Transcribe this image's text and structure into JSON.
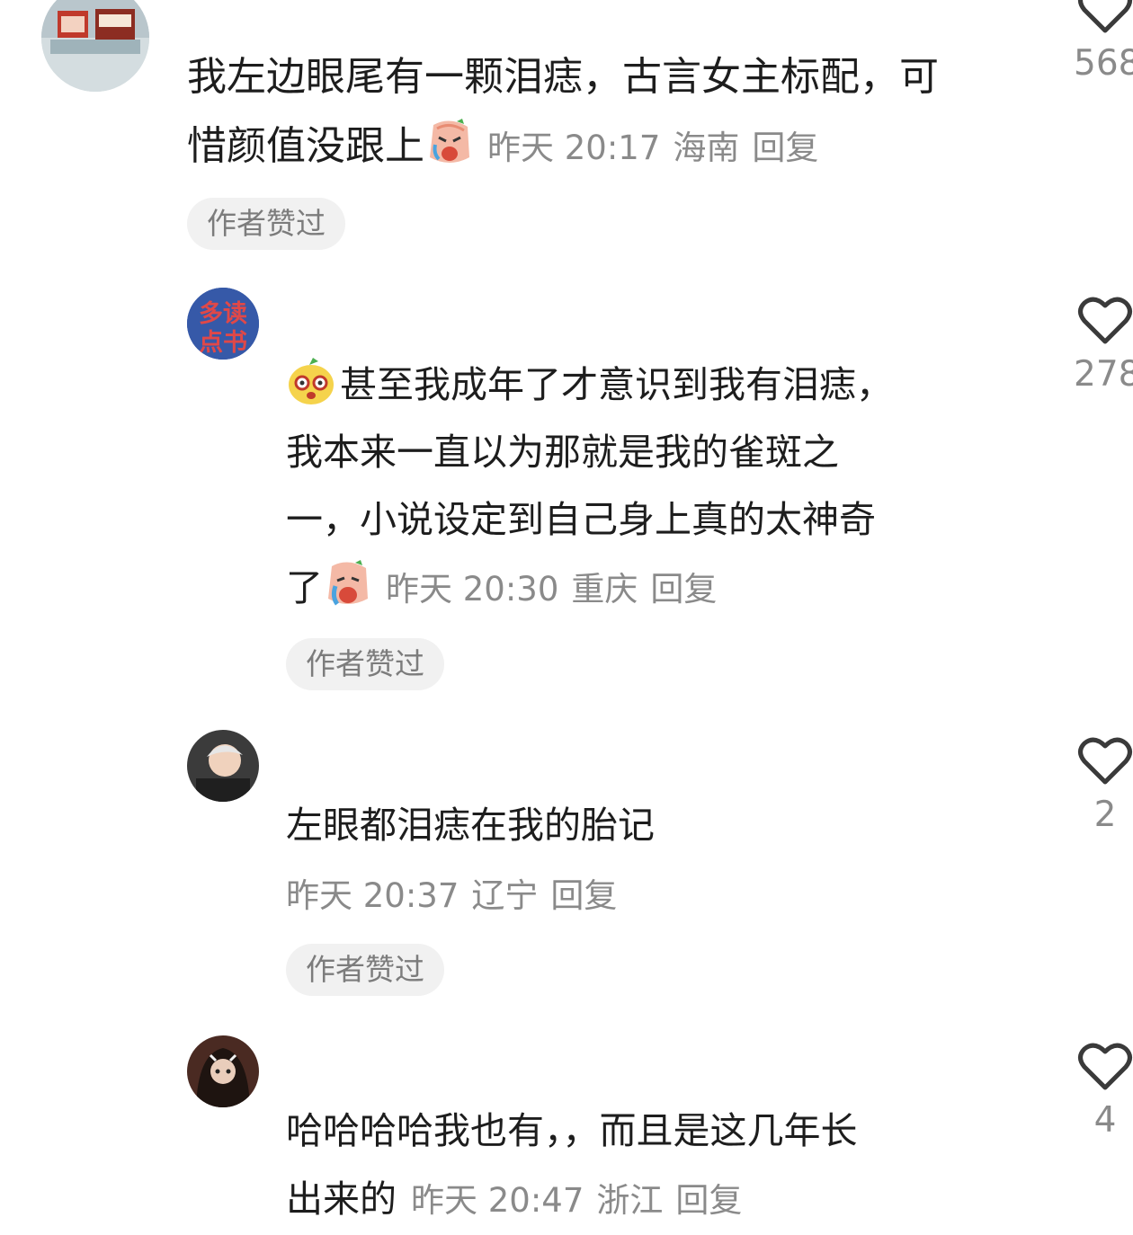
{
  "comments": [
    {
      "text_lines": [
        "我左边眼尾有一颗泪痣，古言女主标配，可",
        "惜颜值没跟上"
      ],
      "emoji": "crying-face-emoji",
      "time": "昨天 20:17",
      "location": "海南",
      "reply": "回复",
      "badge": "作者赞过",
      "likes": "568"
    },
    {
      "avatar_text": "多读点书",
      "lead_emoji": "surprised-face-emoji",
      "text_lines": [
        "甚至我成年了才意识到我有泪痣，",
        "我本来一直以为那就是我的雀斑之",
        "一，小说设定到自己身上真的太神奇",
        "了"
      ],
      "emoji": "crying-face-emoji",
      "time": "昨天 20:30",
      "location": "重庆",
      "reply": "回复",
      "badge": "作者赞过",
      "likes": "278"
    },
    {
      "text_lines": [
        "左眼都泪痣在我的胎记"
      ],
      "time": "昨天 20:37",
      "location": "辽宁",
      "reply": "回复",
      "badge": "作者赞过",
      "likes": "2"
    },
    {
      "text_lines": [
        "哈哈哈哈我也有，，而且是这几年长",
        "出来的"
      ],
      "time": "昨天 20:47",
      "location": "浙江",
      "reply": "回复",
      "likes": "4"
    }
  ],
  "colors": {
    "text": "#1d1d1d",
    "meta": "#8a8a8a",
    "badge_bg": "#f1f1f1",
    "heart": "#3a3a3a"
  }
}
